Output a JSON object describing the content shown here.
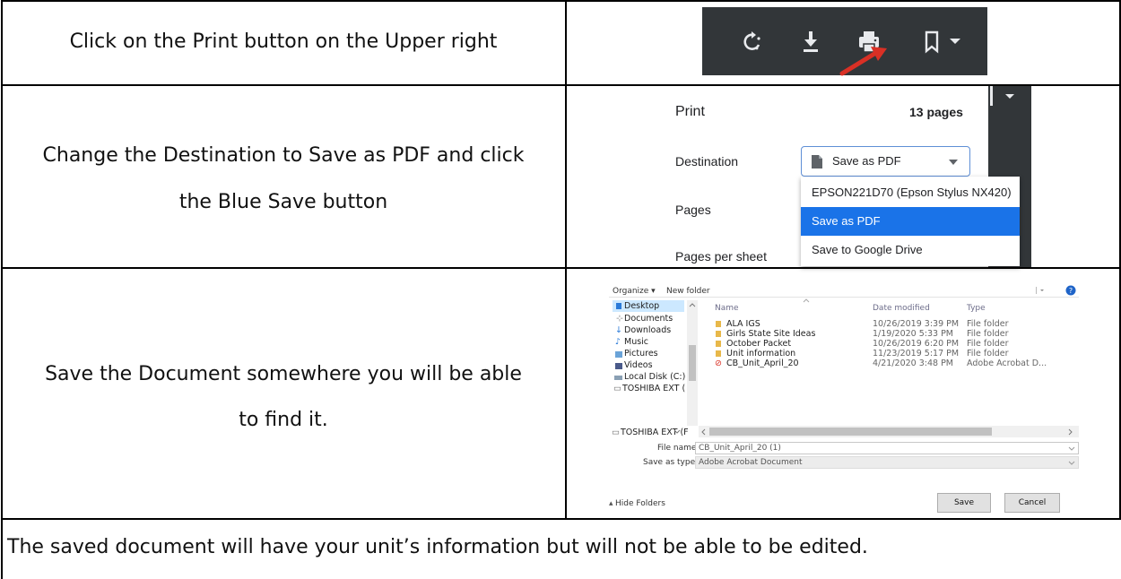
{
  "steps": [
    {
      "text": "Click on the Print button on the Upper right"
    },
    {
      "line1": "Change the Destination to Save as PDF and click",
      "line2": "the Blue Save button"
    },
    {
      "line1": "Save the Document somewhere you will be able",
      "line2": "to find it."
    }
  ],
  "footer": "The saved document will have your unit’s information but will not be able to be edited.",
  "toolbar": {
    "background": "#323639",
    "icons": [
      "rotate-icon",
      "download-icon",
      "print-icon",
      "bookmark-icon",
      "chevron-down-icon"
    ],
    "arrow_color": "#d93025"
  },
  "print_dialog": {
    "title": "Print",
    "page_count": "13 pages",
    "destination_label": "Destination",
    "destination_value": "Save as PDF",
    "pages_label": "Pages",
    "pages_per_sheet_label": "Pages per sheet",
    "menu_options": [
      "EPSON221D70 (Epson Stylus NX420)",
      "Save as PDF",
      "Save to Google Drive"
    ],
    "selected_option": "Save as PDF",
    "accent": "#1a73e8"
  },
  "file_dialog": {
    "organize": "Organize ▾",
    "new_folder": "New folder",
    "columns": {
      "name": "Name",
      "date": "Date modified",
      "type": "Type"
    },
    "nav": [
      "Desktop",
      "Documents",
      "Downloads",
      "Music",
      "Pictures",
      "Videos",
      "Local Disk (C:)",
      "TOSHIBA EXT (",
      "TOSHIBA EXT (F"
    ],
    "files": [
      {
        "name": "ALA IGS",
        "date": "10/26/2019 3:39 PM",
        "type": "File folder"
      },
      {
        "name": "Girls State Site Ideas",
        "date": "1/19/2020 5:33 PM",
        "type": "File folder"
      },
      {
        "name": "October Packet",
        "date": "10/26/2019 6:20 PM",
        "type": "File folder"
      },
      {
        "name": "Unit information",
        "date": "11/23/2019 5:17 PM",
        "type": "File folder"
      },
      {
        "name": "CB_Unit_April_20",
        "date": "4/21/2020 3:48 PM",
        "type": "Adobe Acrobat D..."
      }
    ],
    "file_name_label": "File name:",
    "file_name_value": "CB_Unit_April_20 (1)",
    "save_type_label": "Save as type:",
    "save_type_value": "Adobe Acrobat Document",
    "hide_folders": "Hide Folders",
    "save_button": "Save",
    "cancel_button": "Cancel"
  }
}
